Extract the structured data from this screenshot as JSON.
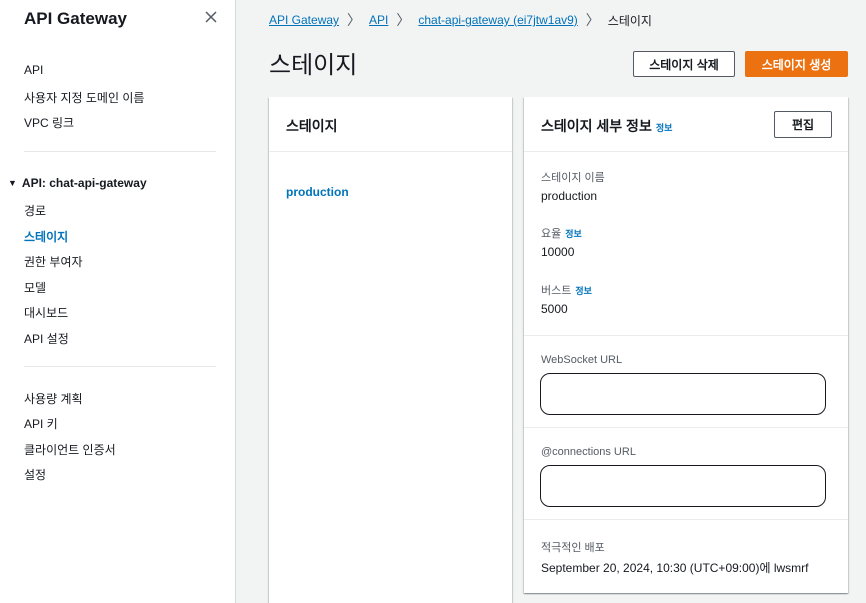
{
  "sidebar": {
    "title": "API Gateway",
    "top_items": [
      "API",
      "사용자 지정 도메인 이름",
      "VPC 링크"
    ],
    "section_title": "API: chat-api-gateway",
    "api_items": [
      "경로",
      "스테이지",
      "권한 부여자",
      "모델",
      "대시보드",
      "API 설정"
    ],
    "bottom_items": [
      "사용량 계획",
      "API 키",
      "클라이언트 인증서",
      "설정"
    ]
  },
  "breadcrumb": {
    "items": [
      "API Gateway",
      "API",
      "chat-api-gateway (ei7jtw1av9)"
    ],
    "current": "스테이지"
  },
  "page": {
    "title": "스테이지",
    "delete_button": "스테이지 삭제",
    "create_button": "스테이지 생성"
  },
  "stages_panel": {
    "title": "스테이지",
    "stages": [
      "production"
    ]
  },
  "details_panel": {
    "title": "스테이지 세부 정보",
    "info_link": "정보",
    "edit_button": "편집",
    "stage_name_label": "스테이지 이름",
    "stage_name_value": "production",
    "rate_label": "요율",
    "rate_info": "정보",
    "rate_value": "10000",
    "burst_label": "버스트",
    "burst_info": "정보",
    "burst_value": "5000",
    "websocket_label": "WebSocket URL",
    "connections_label": "@connections URL",
    "deployment_label": "적극적인 배포",
    "deployment_value": "September 20, 2024, 10:30 (UTC+09:00)에 lwsmrf"
  },
  "colors": {
    "accent": "#ec7211",
    "link": "#0073bb"
  }
}
